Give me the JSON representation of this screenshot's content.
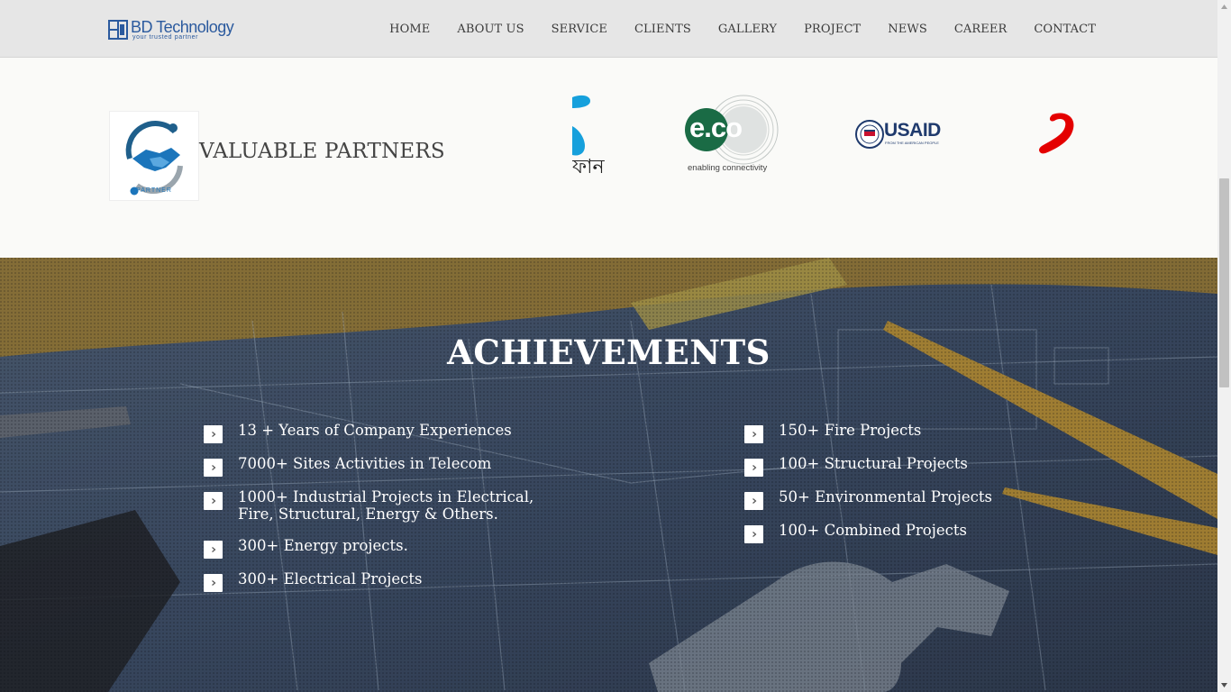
{
  "header": {
    "logo_name": "BD Technology",
    "logo_tagline": "your trusted partner",
    "nav": [
      {
        "label": "HOME"
      },
      {
        "label": "ABOUT US"
      },
      {
        "label": "SERVICE"
      },
      {
        "label": "CLIENTS"
      },
      {
        "label": "GALLERY"
      },
      {
        "label": "PROJECT"
      },
      {
        "label": "NEWS"
      },
      {
        "label": "CAREER"
      },
      {
        "label": "CONTACT"
      }
    ]
  },
  "partners": {
    "badge_text": "PARTNER",
    "title": "VALUABLE PARTNERS",
    "logos": [
      {
        "icon": "grameenphone-logo",
        "text": "ফান"
      },
      {
        "icon": "eco-logo",
        "text": "e.co",
        "tagline": "enabling connectivity"
      },
      {
        "icon": "usaid-logo",
        "text": "USAID",
        "tagline": "FROM THE AMERICAN PEOPLE"
      },
      {
        "icon": "airtel-logo"
      }
    ]
  },
  "achievements": {
    "title": "ACHIEVEMENTS",
    "left": [
      {
        "text": "13 + Years of Company Experiences"
      },
      {
        "text": "7000+ Sites Activities in Telecom"
      },
      {
        "text": "1000+ Industrial Projects in Electrical, Fire, Structural, Energy & Others."
      },
      {
        "text": "300+ Energy projects."
      },
      {
        "text": "300+ Electrical Projects"
      }
    ],
    "right": [
      {
        "text": "150+ Fire Projects"
      },
      {
        "text": "100+ Structural Projects"
      },
      {
        "text": "50+ Environmental Projects"
      },
      {
        "text": "100+ Combined Projects"
      }
    ]
  },
  "colors": {
    "brand_blue": "#2b5a9e",
    "header_bg": "#e6e6e6",
    "achievements_overlay": "#3d4a5c",
    "airtel_red": "#e40000",
    "eco_green": "#1a6b45"
  }
}
